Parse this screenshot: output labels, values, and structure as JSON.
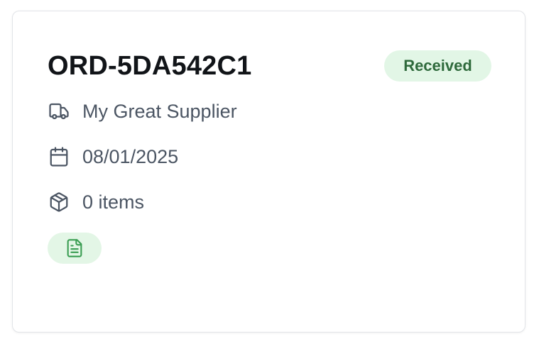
{
  "order": {
    "id": "ORD-5DA542C1",
    "status": "Received",
    "supplier": "My Great Supplier",
    "date": "08/01/2025",
    "items": "0 items"
  },
  "icons": {
    "supplier": "truck-icon",
    "date": "calendar-icon",
    "items": "package-icon",
    "document": "document-icon"
  },
  "colors": {
    "status_bg": "#e2f6e6",
    "status_text": "#2f6a3c",
    "doc_chip_bg": "#e3f6e6",
    "doc_icon": "#3a9d52"
  }
}
